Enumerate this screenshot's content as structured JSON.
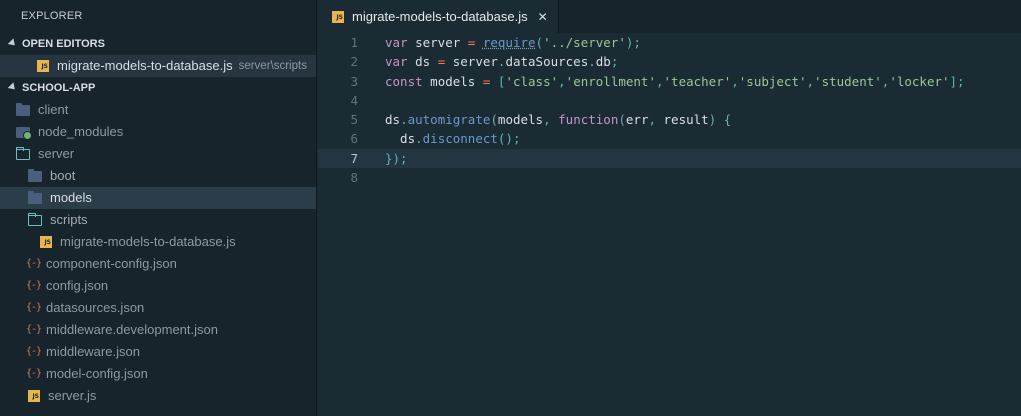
{
  "sidebar": {
    "title": "EXPLORER",
    "open_editors_label": "OPEN EDITORS",
    "open_editor": {
      "name": "migrate-models-to-database.js",
      "path": "server\\scripts"
    },
    "project_label": "SCHOOL-APP",
    "tree": [
      {
        "name": "client"
      },
      {
        "name": "node_modules"
      },
      {
        "name": "server"
      },
      {
        "name": "boot"
      },
      {
        "name": "models"
      },
      {
        "name": "scripts"
      },
      {
        "name": "migrate-models-to-database.js"
      },
      {
        "name": "component-config.json"
      },
      {
        "name": "config.json"
      },
      {
        "name": "datasources.json"
      },
      {
        "name": "middleware.development.json"
      },
      {
        "name": "middleware.json"
      },
      {
        "name": "model-config.json"
      },
      {
        "name": "server.js"
      }
    ]
  },
  "editor": {
    "tab_label": "migrate-models-to-database.js",
    "tab_close": "✕",
    "icon_text": "JS",
    "lines": [
      {
        "n": "1",
        "tokens": [
          [
            "kw",
            "var"
          ],
          [
            "pl",
            " server "
          ],
          [
            "op",
            "="
          ],
          [
            "pl",
            " "
          ],
          [
            "fn",
            "require"
          ],
          [
            "pn",
            "("
          ],
          [
            "str",
            "'../server'"
          ],
          [
            "pn",
            ");"
          ]
        ]
      },
      {
        "n": "2",
        "tokens": [
          [
            "kw",
            "var"
          ],
          [
            "pl",
            " ds "
          ],
          [
            "op",
            "="
          ],
          [
            "pl",
            " server"
          ],
          [
            "pn",
            "."
          ],
          [
            "pl",
            "dataSources"
          ],
          [
            "pn",
            "."
          ],
          [
            "pl",
            "db"
          ],
          [
            "pn",
            ";"
          ]
        ]
      },
      {
        "n": "3",
        "tokens": [
          [
            "kw",
            "const"
          ],
          [
            "pl",
            " models "
          ],
          [
            "op",
            "="
          ],
          [
            "pl",
            " "
          ],
          [
            "pn",
            "["
          ],
          [
            "str",
            "'class'"
          ],
          [
            "pn",
            ","
          ],
          [
            "str",
            "'enrollment'"
          ],
          [
            "pn",
            ","
          ],
          [
            "str",
            "'teacher'"
          ],
          [
            "pn",
            ","
          ],
          [
            "str",
            "'subject'"
          ],
          [
            "pn",
            ","
          ],
          [
            "str",
            "'student'"
          ],
          [
            "pn",
            ","
          ],
          [
            "str",
            "'locker'"
          ],
          [
            "pn",
            "];"
          ]
        ]
      },
      {
        "n": "4",
        "tokens": []
      },
      {
        "n": "5",
        "tokens": [
          [
            "pl",
            "ds"
          ],
          [
            "pn",
            "."
          ],
          [
            "fn",
            "automigrate"
          ],
          [
            "pn",
            "("
          ],
          [
            "pl",
            "models"
          ],
          [
            "pn",
            ", "
          ],
          [
            "kw",
            "function"
          ],
          [
            "pn",
            "("
          ],
          [
            "pl",
            "err"
          ],
          [
            "pn",
            ", "
          ],
          [
            "pl",
            "result"
          ],
          [
            "pn",
            ") {"
          ]
        ]
      },
      {
        "n": "6",
        "tokens": [
          [
            "pl",
            "  ds"
          ],
          [
            "pn",
            "."
          ],
          [
            "fn",
            "disconnect"
          ],
          [
            "pn",
            "();"
          ]
        ]
      },
      {
        "n": "7",
        "tokens": [
          [
            "pn",
            "});"
          ]
        ]
      },
      {
        "n": "8",
        "tokens": []
      }
    ],
    "current_line": "7"
  },
  "colors": {
    "accent_js": "#e8b44c",
    "folder": "#4a5f7e",
    "folder_open": "#66c0c4"
  }
}
